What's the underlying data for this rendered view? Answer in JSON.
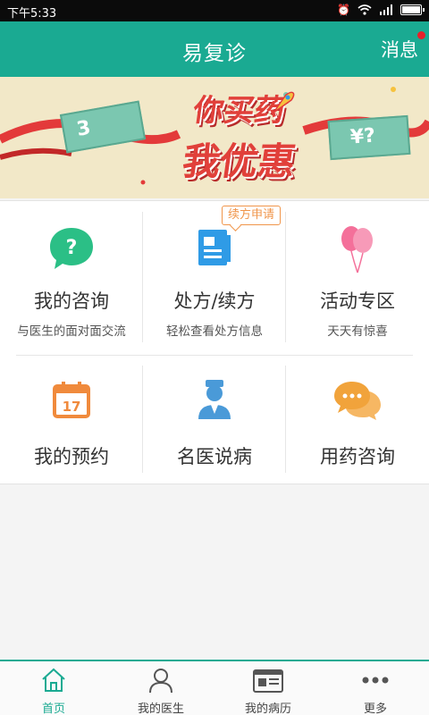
{
  "status_bar": {
    "time": "下午5:33"
  },
  "nav": {
    "title": "易复诊",
    "message_label": "消息"
  },
  "banner": {
    "headline_line1": "你买药",
    "headline_line2": "我优惠",
    "ticket_left_value": "3",
    "ticket_right_value": "¥?"
  },
  "badge": {
    "label": "续方申请"
  },
  "grid": [
    {
      "label": "我的咨询",
      "sub": "与医生的面对面交流",
      "icon": "chat-question-icon",
      "color": "#2bbf86"
    },
    {
      "label": "处方/续方",
      "sub": "轻松查看处方信息",
      "icon": "prescription-icon",
      "color": "#2f9be6"
    },
    {
      "label": "活动专区",
      "sub": "天天有惊喜",
      "icon": "balloons-icon",
      "color": "#f4709a"
    },
    {
      "label": "我的预约",
      "sub": "",
      "icon": "calendar-icon",
      "color": "#f08a3c",
      "calendar_day": "17"
    },
    {
      "label": "名医说病",
      "sub": "",
      "icon": "doctor-icon",
      "color": "#4a9ad8"
    },
    {
      "label": "用药咨询",
      "sub": "",
      "icon": "chat-bubbles-icon",
      "color": "#f1a33b"
    }
  ],
  "tabs": [
    {
      "label": "首页",
      "icon": "home-icon",
      "active": true
    },
    {
      "label": "我的医生",
      "icon": "person-icon",
      "active": false
    },
    {
      "label": "我的病历",
      "icon": "medical-record-icon",
      "active": false
    },
    {
      "label": "更多",
      "icon": "more-icon",
      "active": false
    }
  ],
  "colors": {
    "primary": "#1aaa92",
    "badge": "#f0954a",
    "notify_dot": "#e8202a"
  }
}
